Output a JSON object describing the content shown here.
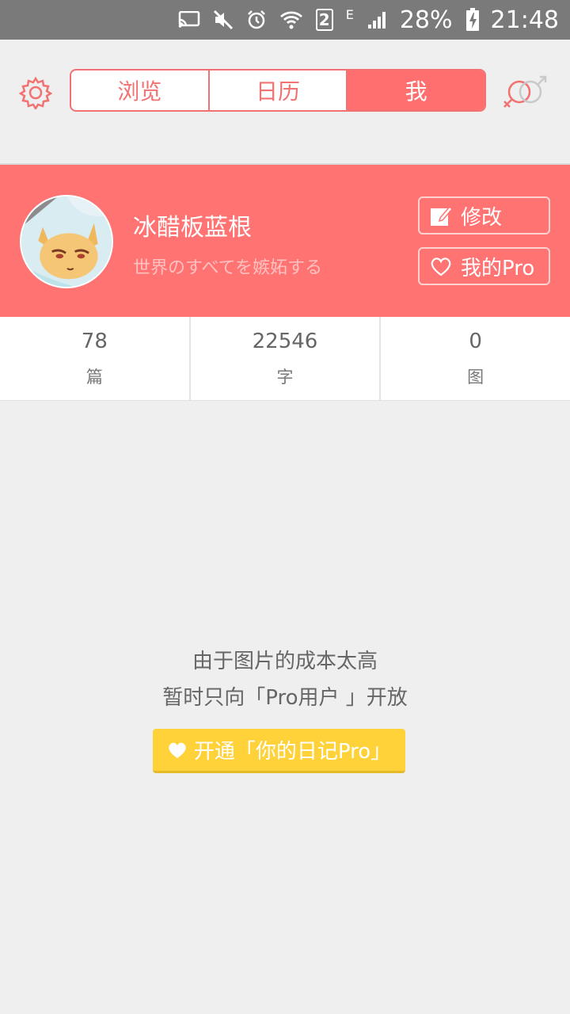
{
  "status_bar": {
    "sim_slot": "2",
    "network_type": "E",
    "battery": "28%",
    "time": "21:48"
  },
  "header": {
    "tabs": [
      {
        "label": "浏览",
        "active": false
      },
      {
        "label": "日历",
        "active": false
      },
      {
        "label": "我",
        "active": true
      }
    ],
    "accent": "#ff6f6f"
  },
  "profile": {
    "name": "冰醋板蓝根",
    "bio": "世界のすべてを嫉妬する",
    "edit_label": "修改",
    "pro_label": "我的Pro",
    "bg": "#ff7373"
  },
  "stats": [
    {
      "value": "78",
      "label": "篇"
    },
    {
      "value": "22546",
      "label": "字"
    },
    {
      "value": "0",
      "label": "图"
    }
  ],
  "notice": {
    "line1": "由于图片的成本太高",
    "line2": "暂时只向「Pro用户 」开放",
    "cta_label": "开通「你的日记Pro」",
    "cta_color": "#ffd23a"
  },
  "icons": {
    "settings": "gear-icon",
    "gender": "gender-icon",
    "edit": "edit-icon",
    "pro": "heart-outline-icon",
    "cta": "heart-icon"
  }
}
